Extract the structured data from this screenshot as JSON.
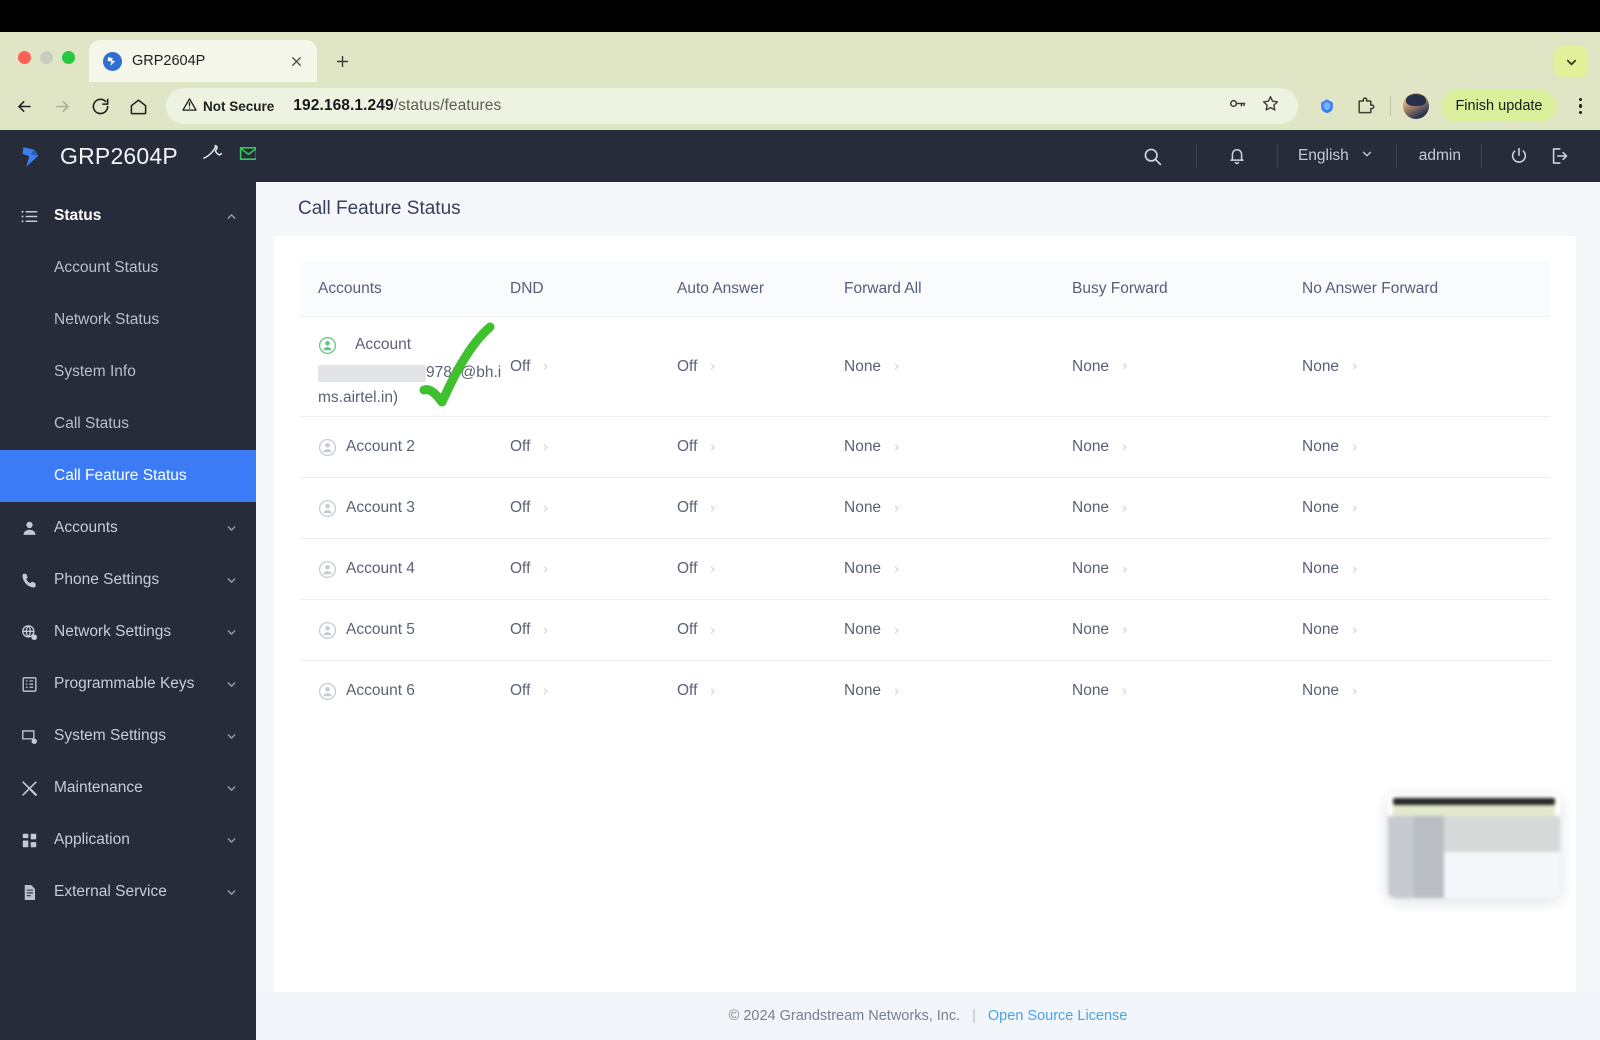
{
  "browser": {
    "tab": {
      "title": "GRP2604P",
      "favicon_icon": "grandstream-favicon",
      "close_icon": "close-icon"
    },
    "new_tab_icon": "plus-icon",
    "tab_list_icon": "chevron-down-icon",
    "nav": {
      "back_icon": "arrow-left-icon",
      "forward_icon": "arrow-right-icon",
      "reload_icon": "reload-icon",
      "home_icon": "home-icon"
    },
    "omnibox": {
      "security_label": "Not Secure",
      "security_icon": "warning-triangle-icon",
      "url_host": "192.168.1.249",
      "url_path": "/status/features",
      "password_icon": "key-icon",
      "bookmark_icon": "star-icon"
    },
    "toolbar_right": {
      "extension_y_icon": "yandex-extension-icon",
      "extensions_icon": "puzzle-piece-icon",
      "profile_icon": "profile-avatar",
      "finish_update_label": "Finish update",
      "menu_icon": "kebab-menu-icon"
    }
  },
  "app_header": {
    "logo_icon": "grandstream-logo",
    "product": "GRP2604P",
    "phone_icon": "phone-handset-icon",
    "mail_icon": "envelope-icon",
    "search_icon": "search-icon",
    "bell_icon": "notification-bell-icon",
    "language": "English",
    "language_chevron_icon": "chevron-down-icon",
    "user": "admin",
    "power_icon": "power-icon",
    "logout_icon": "logout-icon"
  },
  "sidebar": {
    "groups": [
      {
        "label": "Status",
        "icon": "list-icon",
        "expanded": true,
        "chevron": "chevron-up-icon",
        "items": [
          {
            "label": "Account Status",
            "selected": false
          },
          {
            "label": "Network Status",
            "selected": false
          },
          {
            "label": "System Info",
            "selected": false
          },
          {
            "label": "Call Status",
            "selected": false
          },
          {
            "label": "Call Feature Status",
            "selected": true
          }
        ]
      },
      {
        "label": "Accounts",
        "icon": "user-icon",
        "expanded": false,
        "chevron": "chevron-down-icon",
        "items": []
      },
      {
        "label": "Phone Settings",
        "icon": "phone-icon",
        "expanded": false,
        "chevron": "chevron-down-icon",
        "items": []
      },
      {
        "label": "Network Settings",
        "icon": "globe-gear-icon",
        "expanded": false,
        "chevron": "chevron-down-icon",
        "items": []
      },
      {
        "label": "Programmable Keys",
        "icon": "keypad-icon",
        "expanded": false,
        "chevron": "chevron-down-icon",
        "items": []
      },
      {
        "label": "System Settings",
        "icon": "monitor-gear-icon",
        "expanded": false,
        "chevron": "chevron-down-icon",
        "items": []
      },
      {
        "label": "Maintenance",
        "icon": "tools-icon",
        "expanded": false,
        "chevron": "chevron-down-icon",
        "items": []
      },
      {
        "label": "Application",
        "icon": "grid-apps-icon",
        "expanded": false,
        "chevron": "chevron-down-icon",
        "items": []
      },
      {
        "label": "External Service",
        "icon": "document-icon",
        "expanded": false,
        "chevron": "chevron-down-icon",
        "items": []
      }
    ]
  },
  "main": {
    "page_title": "Call Feature Status",
    "table": {
      "columns": [
        "Accounts",
        "DND",
        "Auto Answer",
        "Forward All",
        "Busy Forward",
        "No Answer Forward"
      ],
      "rows": [
        {
          "account_label": "Account",
          "account_detail_redacted": true,
          "account_detail": "9786@bh.ims.airtel.in)",
          "account_active": true,
          "dnd": "Off",
          "auto_answer": "Off",
          "forward_all": "None",
          "busy_forward": "None",
          "no_answer_forward": "None"
        },
        {
          "account_label": "Account 2",
          "account_active": false,
          "dnd": "Off",
          "auto_answer": "Off",
          "forward_all": "None",
          "busy_forward": "None",
          "no_answer_forward": "None"
        },
        {
          "account_label": "Account 3",
          "account_active": false,
          "dnd": "Off",
          "auto_answer": "Off",
          "forward_all": "None",
          "busy_forward": "None",
          "no_answer_forward": "None"
        },
        {
          "account_label": "Account 4",
          "account_active": false,
          "dnd": "Off",
          "auto_answer": "Off",
          "forward_all": "None",
          "busy_forward": "None",
          "no_answer_forward": "None"
        },
        {
          "account_label": "Account 5",
          "account_active": false,
          "dnd": "Off",
          "auto_answer": "Off",
          "forward_all": "None",
          "busy_forward": "None",
          "no_answer_forward": "None"
        },
        {
          "account_label": "Account 6",
          "account_active": false,
          "dnd": "Off",
          "auto_answer": "Off",
          "forward_all": "None",
          "busy_forward": "None",
          "no_answer_forward": "None"
        }
      ]
    },
    "annotation": {
      "shape": "green-checkmark",
      "color": "#3fc02f"
    }
  },
  "footer": {
    "copyright": "© 2024 Grandstream Networks, Inc.",
    "separator": "|",
    "link_label": "Open Source License"
  },
  "colors": {
    "accent_blue": "#3b7cf6",
    "sidebar_bg": "#262c3a",
    "chrome_bg": "#dfe5c5",
    "update_pill": "#d9ef9b",
    "link": "#4ba3e3",
    "active_account_green": "#5ec77f"
  }
}
